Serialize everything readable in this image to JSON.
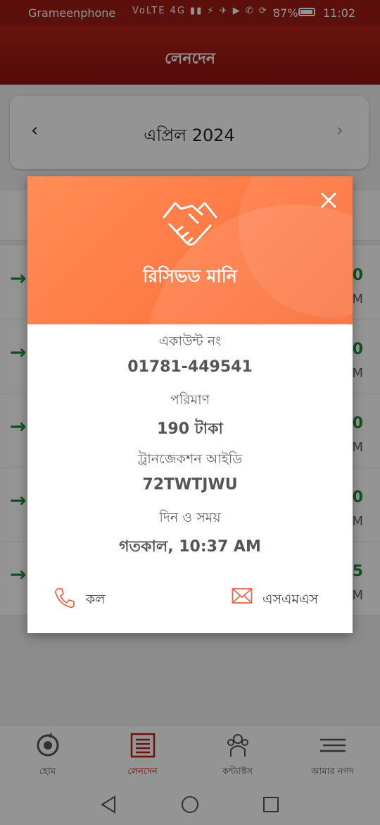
{
  "status_bar": {
    "carrier": "Grameenphone",
    "icons": "VoLTE 4G ▮▮ ⚡ ✈ ▶ ✆ ⟳ ···",
    "battery": "87%",
    "time": "11:02"
  },
  "app_bar": {
    "title": "লেনদেন"
  },
  "month_nav": {
    "prev": "‹",
    "month": "এপ্রিল 2024",
    "next": "›"
  },
  "transactions": [
    {
      "amount": "0",
      "time": "M"
    },
    {
      "amount": "0",
      "time": "M"
    },
    {
      "amount": "0",
      "time": "M"
    },
    {
      "amount": "0",
      "time": "M"
    },
    {
      "amount": "5",
      "time": "M"
    }
  ],
  "modal": {
    "title": "রিসিভড মানি",
    "account_label": "একাউন্ট নং",
    "account_value": "01781-449541",
    "amount_label": "পরিমাণ",
    "amount_value": "190 টাকা",
    "txid_label": "ট্রানজেকশন আইডি",
    "txid_value": "72TWTJWU",
    "datetime_label": "দিন ও সময়",
    "datetime_value": "গতকাল, 10:37 AM",
    "call_label": "কল",
    "sms_label": "এসএমএস"
  },
  "bottom_nav": [
    {
      "label": "হোম",
      "icon": "home-icon"
    },
    {
      "label": "লেনদেন",
      "icon": "transactions-icon"
    },
    {
      "label": "কন্ট্যাক্টস",
      "icon": "contacts-icon"
    },
    {
      "label": "আমার নগদ",
      "icon": "menu-icon"
    }
  ],
  "colors": {
    "brand_red": "#b52219",
    "modal_orange": "#ff7a45",
    "credit_green": "#1f8a3a"
  }
}
